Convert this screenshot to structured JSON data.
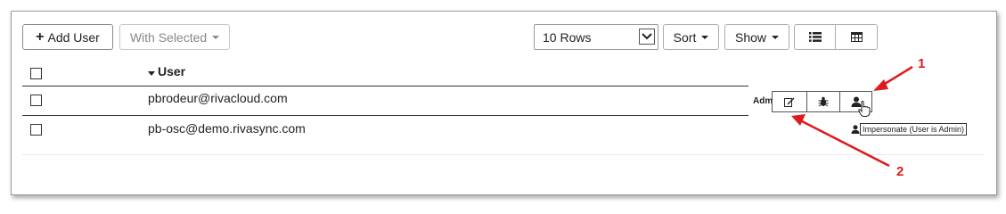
{
  "toolbar": {
    "add_user_label": "Add User",
    "with_selected_label": "With Selected",
    "rows_select_value": "10 Rows",
    "sort_label": "Sort",
    "show_label": "Show"
  },
  "table": {
    "column_user": "User",
    "rows": [
      {
        "user": "pbrodeur@rivacloud.com"
      },
      {
        "user": "pb-osc@demo.rivasync.com"
      }
    ]
  },
  "row_actions": {
    "partial_label": "Adm",
    "tooltip": "Impersonate (User is Admin)"
  },
  "callouts": {
    "one": "1",
    "two": "2",
    "color": "#e0191c"
  },
  "icons": [
    "plus-icon",
    "caret-down-icon",
    "list-view-icon",
    "grid-view-icon",
    "edit-icon",
    "bug-icon",
    "user-icon",
    "hand-cursor-icon"
  ]
}
